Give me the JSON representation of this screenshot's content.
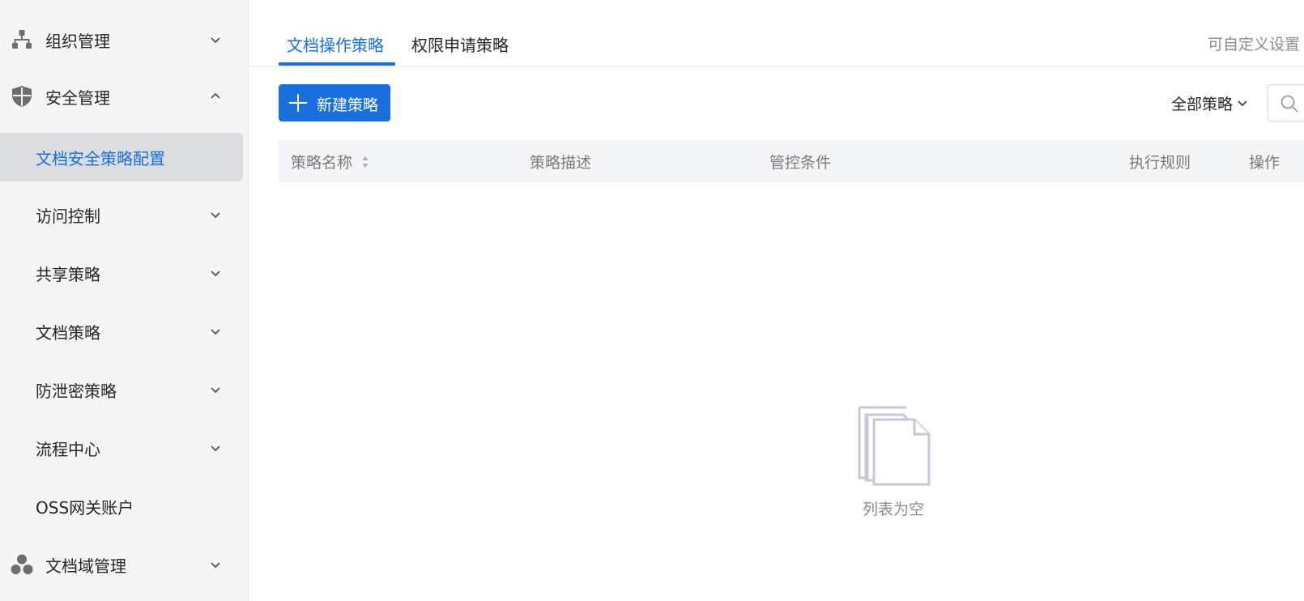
{
  "sidebar": {
    "items": [
      {
        "label": "组织管理",
        "icon": "org-tree-icon",
        "level": "top",
        "expanded": false
      },
      {
        "label": "安全管理",
        "icon": "shield-icon",
        "level": "top",
        "expanded": true
      },
      {
        "label": "文档安全策略配置",
        "level": "sub",
        "active": true
      },
      {
        "label": "访问控制",
        "level": "sub",
        "expanded": false
      },
      {
        "label": "共享策略",
        "level": "sub",
        "expanded": false
      },
      {
        "label": "文档策略",
        "level": "sub",
        "expanded": false
      },
      {
        "label": "防泄密策略",
        "level": "sub",
        "expanded": false
      },
      {
        "label": "流程中心",
        "level": "sub",
        "expanded": false
      },
      {
        "label": "OSS网关账户",
        "level": "sub"
      },
      {
        "label": "文档域管理",
        "icon": "cluster-icon",
        "level": "top",
        "expanded": false
      }
    ]
  },
  "tabs": [
    {
      "label": "文档操作策略",
      "active": true
    },
    {
      "label": "权限申请策略",
      "active": false
    }
  ],
  "header": {
    "customize_link": "可自定义设置"
  },
  "toolbar": {
    "new_button_label": "新建策略",
    "filter_label": "全部策略"
  },
  "table": {
    "columns": [
      "策略名称",
      "策略描述",
      "管控条件",
      "执行规则",
      "操作"
    ],
    "rows": []
  },
  "empty_state": {
    "text": "列表为空"
  },
  "colors": {
    "accent": "#1a6fdc",
    "sidebar_bg": "#f5f5f5",
    "active_item_bg": "#dcdde0",
    "table_header_bg": "#f4f5f8"
  }
}
